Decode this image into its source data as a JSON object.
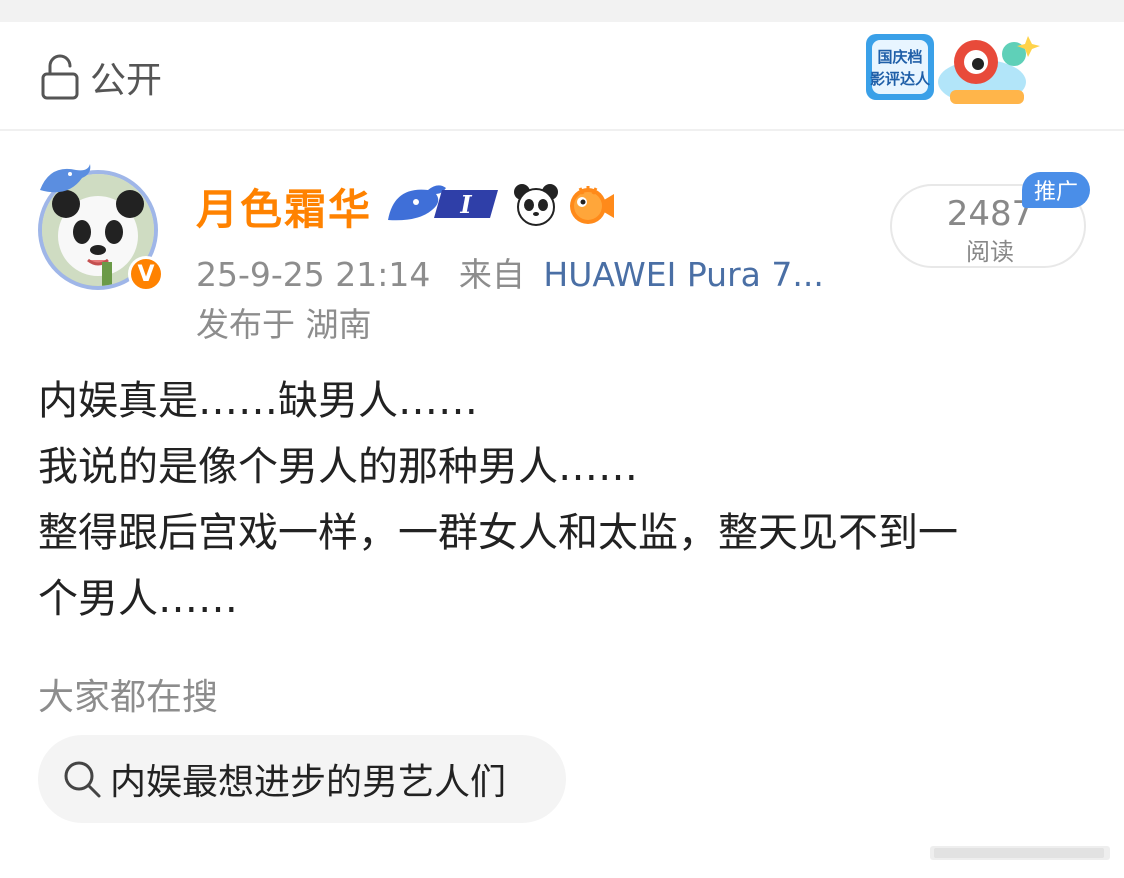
{
  "visibility": {
    "label": "公开",
    "icon": "unlock-icon"
  },
  "event_badge": {
    "text_line1": "国庆档",
    "text_line2": "影评达人"
  },
  "author": {
    "name": "月色霜华",
    "verified_mark": "V",
    "level_badge_text": "I",
    "badges": [
      "whale-level-badge",
      "panda-icon",
      "pufferfish-icon"
    ]
  },
  "meta": {
    "datetime": "25-9-25 21:14",
    "from_label": "来自",
    "device": "HUAWEI Pura 7...",
    "location": "发布于 湖南"
  },
  "reads": {
    "count": "2487",
    "label": "阅读",
    "promo_tag": "推广"
  },
  "post": {
    "lines": [
      "内娱真是……缺男人……",
      "我说的是像个男人的那种男人……",
      "整得跟后宫戏一样，一群女人和太监，整天见不到一",
      "个男人……"
    ]
  },
  "trending": {
    "title": "大家都在搜",
    "query": "内娱最想进步的男艺人们"
  },
  "colors": {
    "accent_orange": "#ff8200",
    "link_blue": "#4a6fa5",
    "promo_blue": "#4a8ee8",
    "muted_text": "#8d8d8d"
  }
}
